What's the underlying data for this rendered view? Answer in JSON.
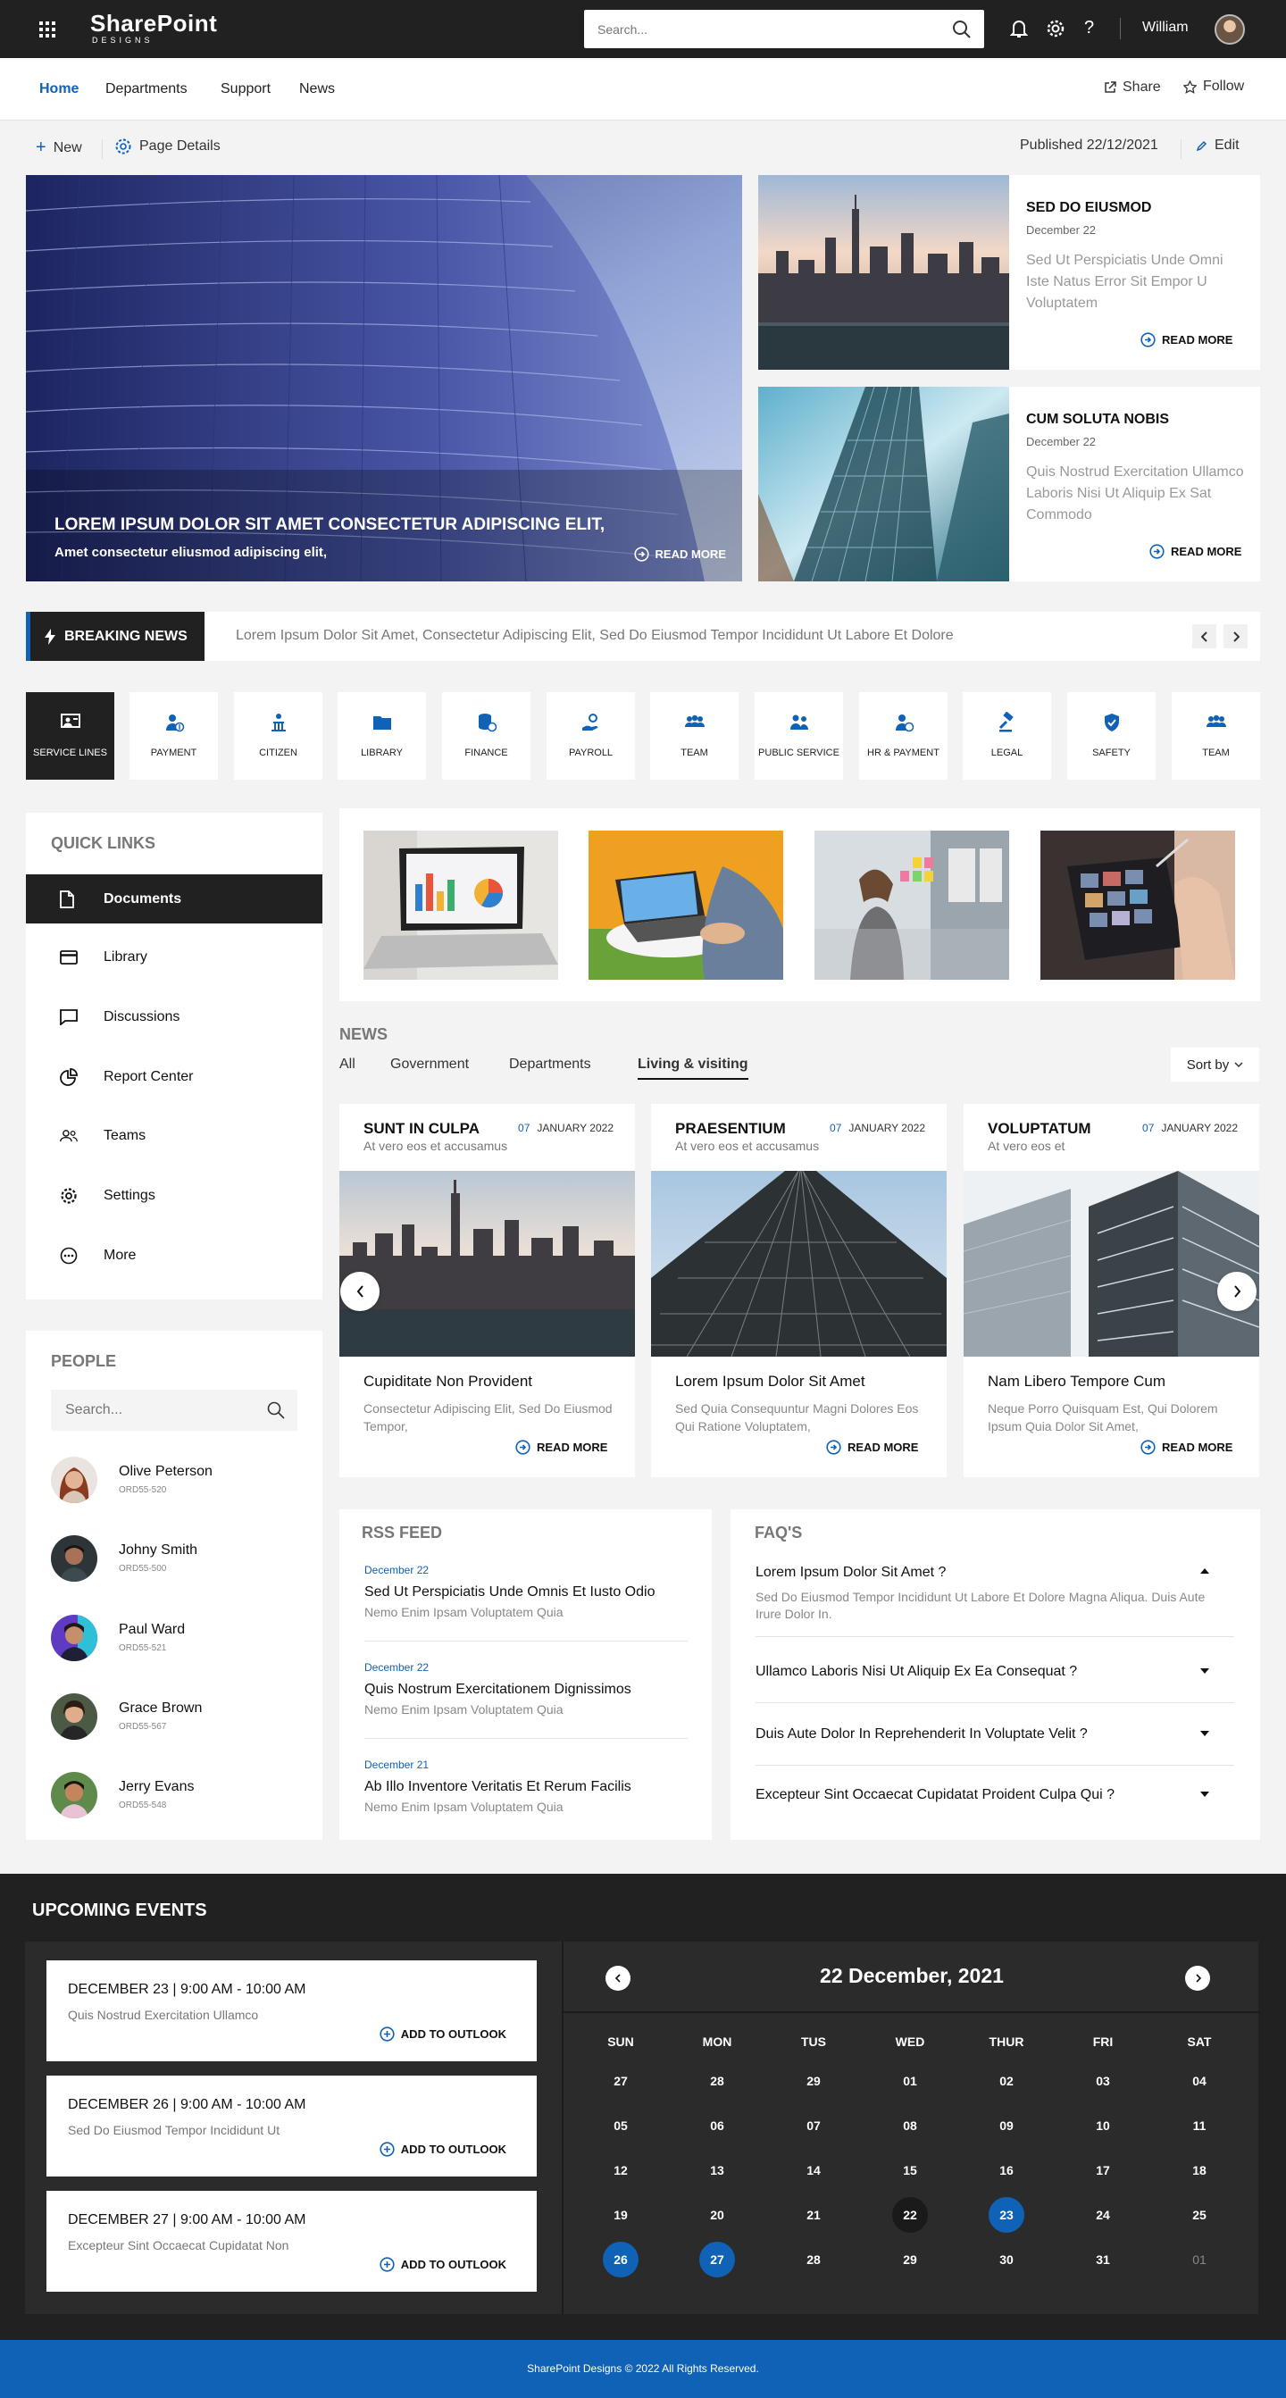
{
  "app": {
    "logo_main": "SharePoint",
    "logo_sub": "DESIGNS"
  },
  "topbar": {
    "search_placeholder": "Search...",
    "user_name": "William",
    "icons": [
      "waffle-icon",
      "search-icon",
      "bell-icon",
      "gear-icon",
      "help-icon",
      "avatar"
    ]
  },
  "nav": {
    "items": [
      "Home",
      "Departments",
      "Support",
      "News"
    ],
    "active": "Home",
    "share": "Share",
    "follow": "Follow"
  },
  "commandbar": {
    "new": "New",
    "page_details": "Page Details",
    "published": "Published 22/12/2021",
    "edit": "Edit"
  },
  "hero": {
    "title": "LOREM IPSUM DOLOR SIT AMET CONSECTETUR ADIPISCING ELIT,",
    "subtitle": "Amet consectetur eliusmod adipiscing elit,",
    "read_more": "READ MORE"
  },
  "side_cards": [
    {
      "title": "SED DO EIUSMOD",
      "date": "December 22",
      "text": "Sed Ut Perspiciatis Unde Omni Iste Natus Error Sit Empor U Voluptatem",
      "read_more": "READ MORE"
    },
    {
      "title": "CUM SOLUTA NOBIS",
      "date": "December 22",
      "text": "Quis Nostrud Exercitation Ullamco Laboris Nisi Ut Aliquip Ex Sat Commodo",
      "read_more": "READ MORE"
    }
  ],
  "breaking": {
    "label": "BREAKING NEWS",
    "text": "Lorem Ipsum Dolor Sit Amet, Consectetur Adipiscing Elit, Sed Do Eiusmod Tempor Incididunt Ut Labore Et Dolore"
  },
  "tiles": [
    "SERVICE LINES",
    "PAYMENT",
    "CITIZEN",
    "LIBRARY",
    "FINANCE",
    "PAYROLL",
    "TEAM",
    "PUBLIC SERVICE",
    "HR & PAYMENT",
    "LEGAL",
    "SAFETY",
    "TEAM"
  ],
  "quick_links": {
    "title": "QUICK LINKS",
    "items": [
      "Documents",
      "Library",
      "Discussions",
      "Report Center",
      "Teams",
      "Settings",
      "More"
    ],
    "active": "Documents"
  },
  "news": {
    "title": "NEWS",
    "tabs": [
      "All",
      "Government",
      "Departments",
      "Living & visiting"
    ],
    "active_tab": "Living & visiting",
    "sort_label": "Sort by",
    "cards": [
      {
        "title": "SUNT IN CULPA",
        "subtitle": "At vero eos et accusamus",
        "day": "07",
        "month": "JANUARY 2022",
        "heading": "Cupiditate Non Provident",
        "text": "Consectetur Adipiscing Elit, Sed Do Eiusmod Tempor,",
        "read_more": "READ MORE"
      },
      {
        "title": "PRAESENTIUM",
        "subtitle": "At vero eos et accusamus",
        "day": "07",
        "month": "JANUARY 2022",
        "heading": "Lorem Ipsum Dolor Sit Amet",
        "text": "Sed Quia Consequuntur Magni Dolores Eos Qui Ratione Voluptatem,",
        "read_more": "READ MORE"
      },
      {
        "title": "VOLUPTATUM",
        "subtitle": "At vero eos et",
        "day": "07",
        "month": "JANUARY 2022",
        "heading": "Nam Libero Tempore Cum",
        "text": "Neque Porro Quisquam Est, Qui Dolorem Ipsum Quia Dolor Sit Amet,",
        "read_more": "READ MORE"
      }
    ]
  },
  "people": {
    "title": "PEOPLE",
    "search_placeholder": "Search...",
    "list": [
      {
        "name": "Olive Peterson",
        "id": "ORD55-520"
      },
      {
        "name": "Johny Smith",
        "id": "ORD55-500"
      },
      {
        "name": "Paul Ward",
        "id": "ORD55-521"
      },
      {
        "name": "Grace Brown",
        "id": "ORD55-567"
      },
      {
        "name": "Jerry Evans",
        "id": "ORD55-548"
      }
    ]
  },
  "rss": {
    "title": "RSS FEED",
    "items": [
      {
        "date": "December 22",
        "title": "Sed Ut Perspiciatis Unde Omnis Et Iusto Odio",
        "sub": "Nemo Enim Ipsam Voluptatem Quia"
      },
      {
        "date": "December 22",
        "title": "Quis Nostrum Exercitationem  Dignissimos",
        "sub": "Nemo Enim Ipsam Voluptatem Quia"
      },
      {
        "date": "December 21",
        "title": "Ab Illo Inventore Veritatis Et Rerum Facilis",
        "sub": "Nemo Enim Ipsam Voluptatem Quia"
      }
    ]
  },
  "faq": {
    "title": "FAQ'S",
    "items": [
      {
        "q": "Lorem Ipsum Dolor Sit Amet ?",
        "a": "Sed Do Eiusmod Tempor Incididunt Ut Labore Et Dolore Magna Aliqua. Duis Aute Irure Dolor In.",
        "open": true
      },
      {
        "q": "Ullamco Laboris Nisi Ut Aliquip Ex Ea Consequat ?",
        "a": "",
        "open": false
      },
      {
        "q": "Duis Aute Dolor In Reprehenderit In Voluptate Velit ?",
        "a": "",
        "open": false
      },
      {
        "q": "Excepteur Sint Occaecat Cupidatat Proident Culpa Qui ?",
        "a": "",
        "open": false
      }
    ]
  },
  "events": {
    "title": "UPCOMING EVENTS",
    "items": [
      {
        "date": "DECEMBER 23 | 9:00 AM - 10:00 AM",
        "text": "Quis Nostrud Exercitation Ullamco",
        "action": "ADD TO OUTLOOK"
      },
      {
        "date": "DECEMBER 26 | 9:00 AM - 10:00 AM",
        "text": "Sed Do Eiusmod Tempor Incididunt Ut",
        "action": "ADD TO OUTLOOK"
      },
      {
        "date": "DECEMBER 27 | 9:00 AM - 10:00 AM",
        "text": "Excepteur Sint Occaecat Cupidatat Non",
        "action": "ADD TO OUTLOOK"
      }
    ]
  },
  "calendar": {
    "title": "22 December, 2021",
    "weekdays": [
      "SUN",
      "MON",
      "TUS",
      "WED",
      "THUR",
      "FRI",
      "SAT"
    ],
    "weeks": [
      [
        "27",
        "28",
        "29",
        "01",
        "02",
        "03",
        "04"
      ],
      [
        "05",
        "06",
        "07",
        "08",
        "09",
        "10",
        "11"
      ],
      [
        "12",
        "13",
        "14",
        "15",
        "16",
        "17",
        "18"
      ],
      [
        "19",
        "20",
        "21",
        "22",
        "23",
        "24",
        "25"
      ],
      [
        "26",
        "27",
        "28",
        "29",
        "30",
        "31",
        "01"
      ]
    ],
    "today": "22",
    "highlighted": [
      "23",
      "26",
      "27"
    ]
  },
  "footer": {
    "text": "SharePoint Designs © 2022 All Rights Reserved."
  },
  "colors": {
    "accent": "#0f62b5",
    "dark": "#212121",
    "bg": "#f3f3f3"
  }
}
